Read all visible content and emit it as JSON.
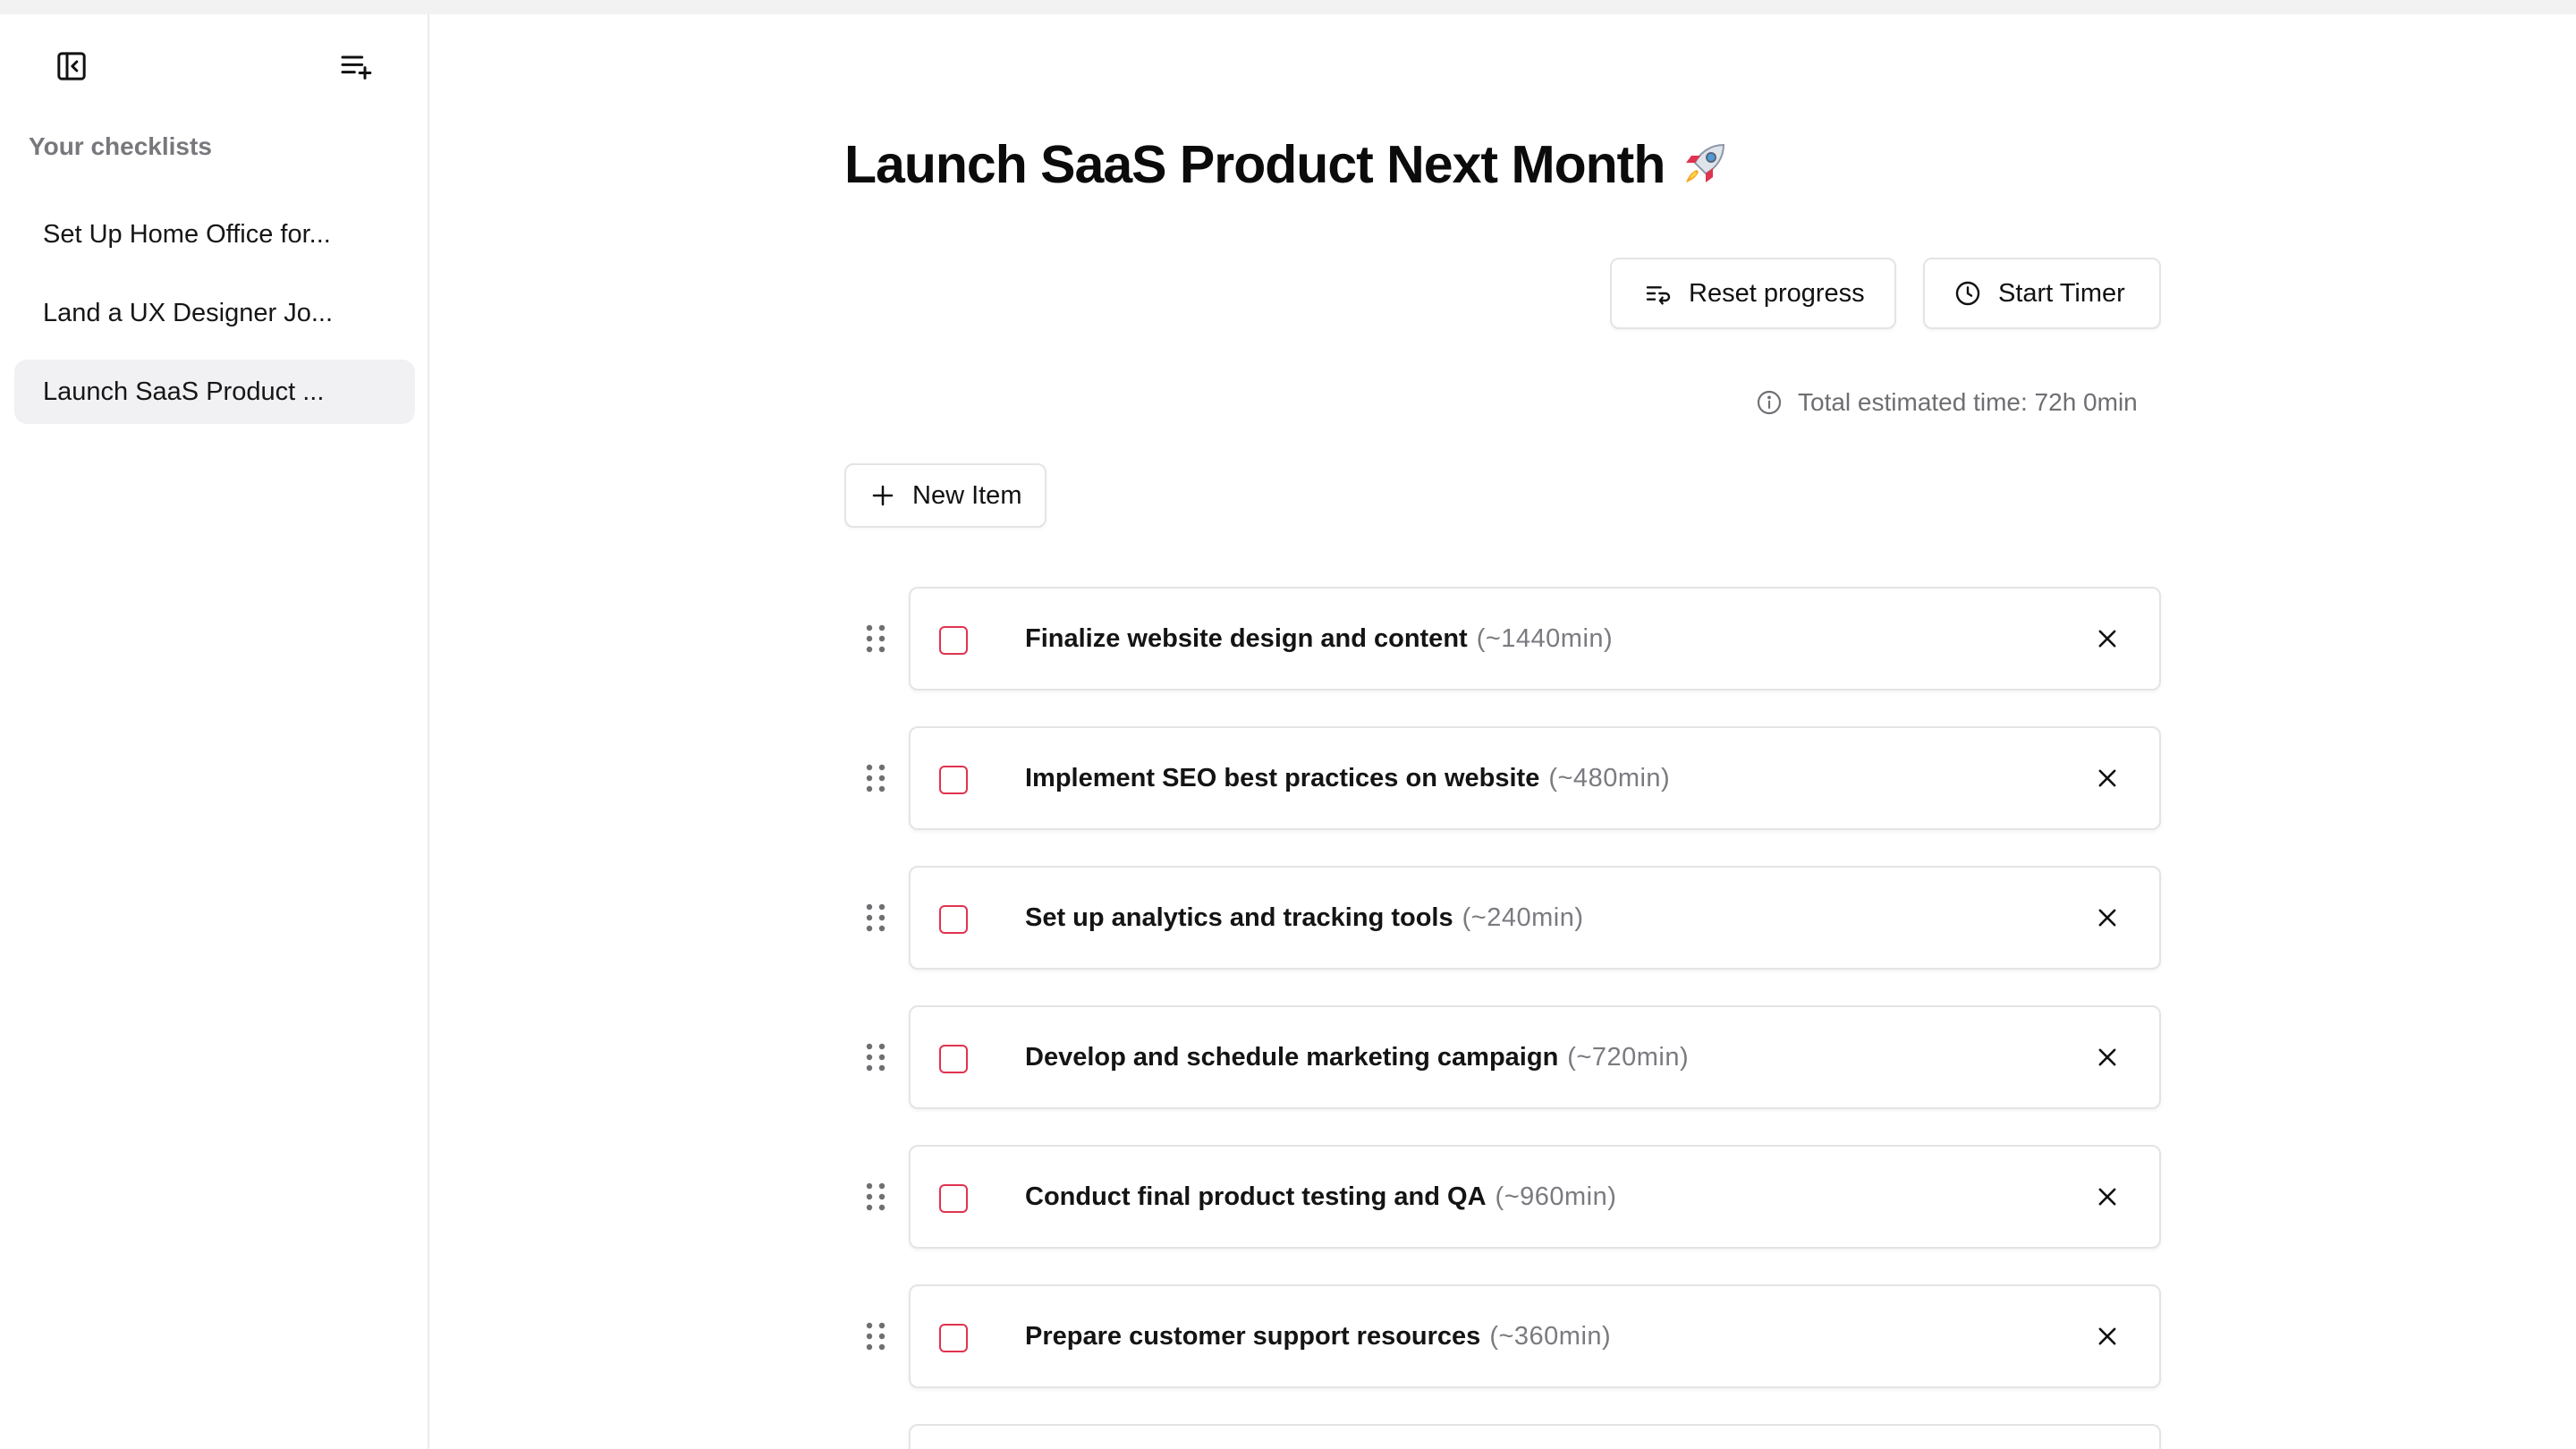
{
  "sidebar": {
    "heading": "Your checklists",
    "items": [
      {
        "label": "Set Up Home Office for...",
        "active": false
      },
      {
        "label": "Land a UX Designer Jo...",
        "active": false
      },
      {
        "label": "Launch SaaS Product ...",
        "active": true
      }
    ]
  },
  "page": {
    "title": "Launch SaaS Product Next Month",
    "reset_label": "Reset progress",
    "timer_label": "Start Timer",
    "estimated_time": "Total estimated time: 72h 0min",
    "new_item_label": "New Item"
  },
  "checklist": [
    {
      "label": "Finalize website design and content",
      "time": "(~1440min)"
    },
    {
      "label": "Implement SEO best practices on website",
      "time": "(~480min)"
    },
    {
      "label": "Set up analytics and tracking tools",
      "time": "(~240min)"
    },
    {
      "label": "Develop and schedule marketing campaign",
      "time": "(~720min)"
    },
    {
      "label": "Conduct final product testing and QA",
      "time": "(~960min)"
    },
    {
      "label": "Prepare customer support resources",
      "time": "(~360min)"
    }
  ],
  "colors": {
    "checkbox_border": "#e0334f",
    "active_item_bg": "#f1f1f3",
    "muted_text": "#6e6e73"
  },
  "icons": {
    "collapse": "sidebar-collapse-icon",
    "new_list": "list-add-icon",
    "reset": "reset-list-icon",
    "timer": "clock-icon",
    "info": "info-icon",
    "plus": "plus-icon",
    "drag": "drag-handle-icon",
    "remove": "close-icon"
  }
}
